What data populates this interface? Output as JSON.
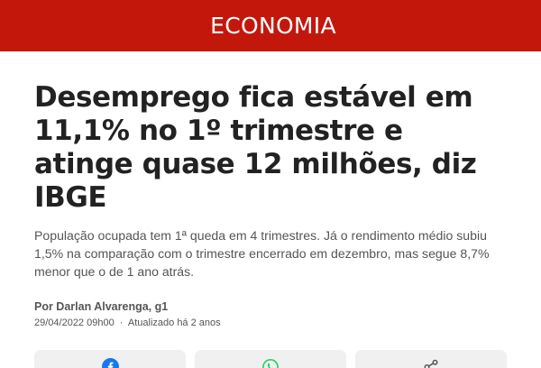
{
  "header": {
    "section": "ECONOMIA",
    "background_color": "#c4170c"
  },
  "article": {
    "headline": "Desemprego fica estável em 11,1% no 1º trimestre e atinge quase 12 milhões, diz IBGE",
    "subtitle": "População ocupada tem 1ª queda em 4 trimestres. Já o rendimento médio subiu 1,5% na comparação com o trimestre encerrado em dezembro, mas segue 8,7% menor que o de 1 ano atrás.",
    "byline": "Por Darlan Alvarenga, g1",
    "published": "29/04/2022 09h00",
    "separator": "·",
    "updated": "Atualizado há 2 anos"
  },
  "share": {
    "buttons": [
      {
        "icon": "facebook-icon",
        "color": "#1877f2"
      },
      {
        "icon": "whatsapp-icon",
        "color": "#25d366"
      },
      {
        "icon": "share-icon",
        "color": "#555555"
      }
    ]
  }
}
